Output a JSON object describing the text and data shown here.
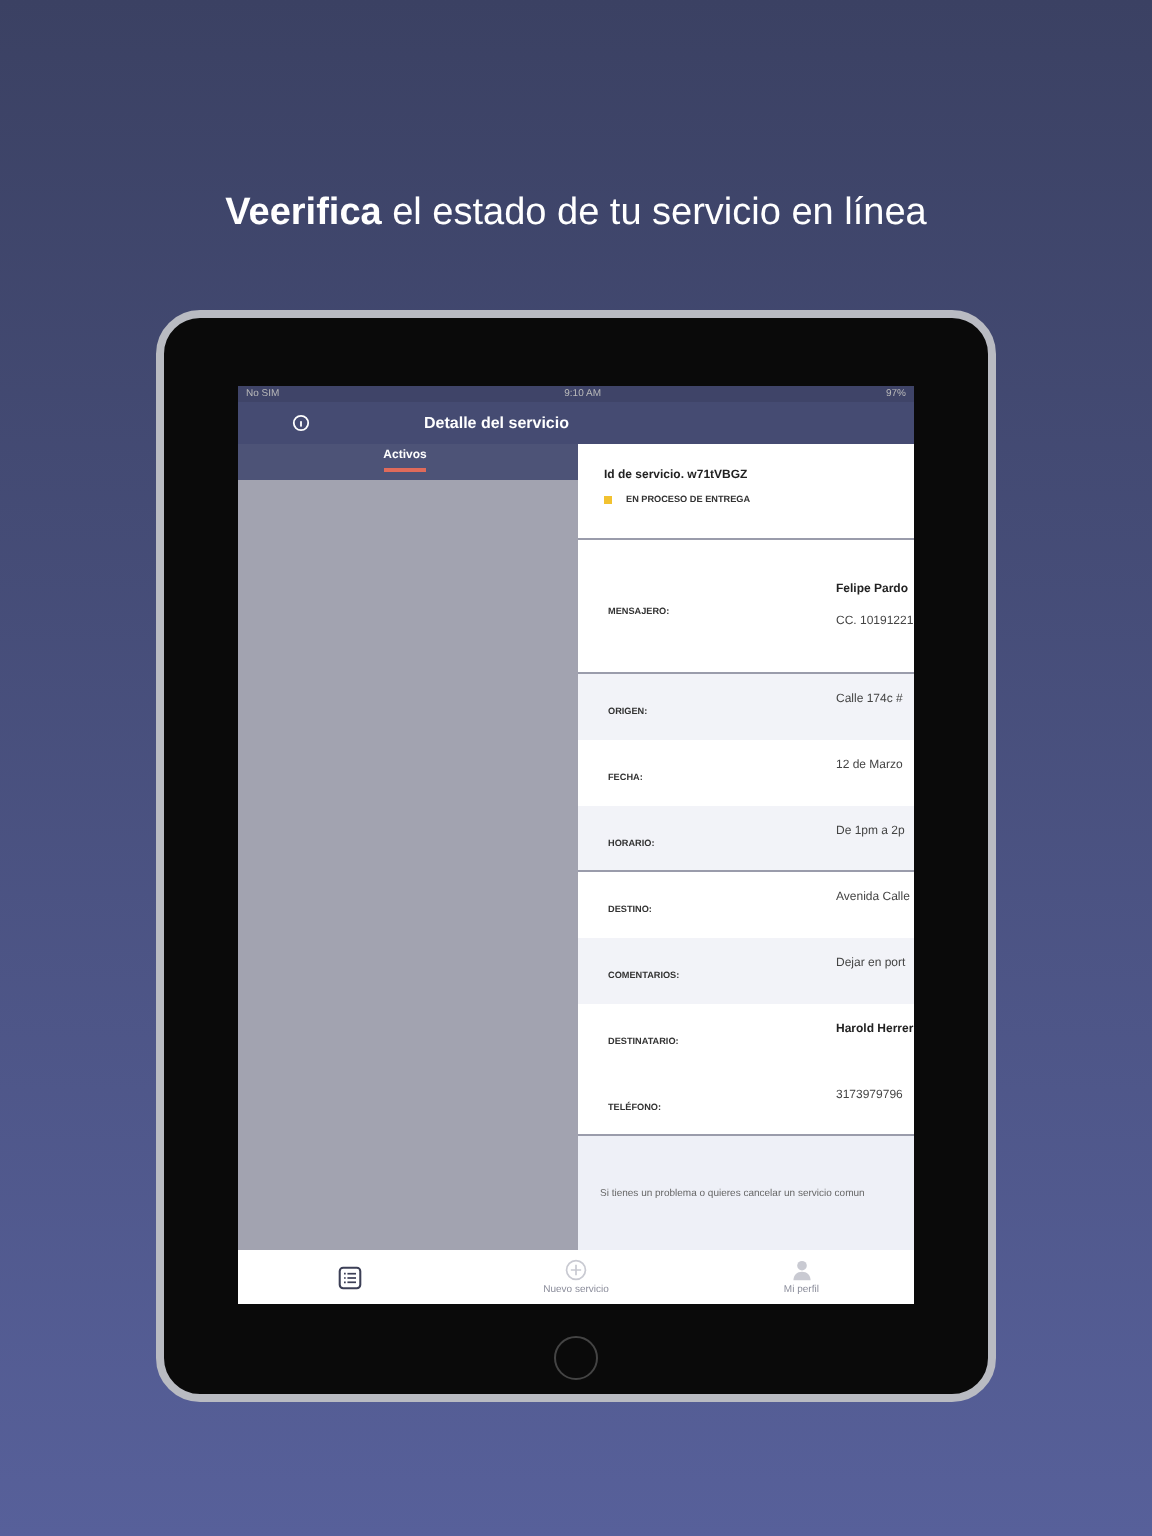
{
  "headline": "**Veerifica** el estado de tu servicio en línea",
  "status_bar": {
    "carrier": "No SIM",
    "time": "9:10 AM",
    "battery": "97%"
  },
  "nav": {
    "title": "Detalle del servicio"
  },
  "tabs": [
    {
      "label": "Activos",
      "selected": true
    }
  ],
  "service": {
    "id": "Id de servicio. w71tVBGZ",
    "status": {
      "text": "EN PROCESO DE ENTREGA",
      "color": "#f2c230"
    }
  },
  "rows": [
    {
      "label": "MENSAJERO:",
      "value": "Felipe Pardo",
      "value_2": "CC. 10191221",
      "emphasis": true,
      "shaded": false,
      "divider_after": true
    },
    {
      "label": "ORIGEN:",
      "value": "Calle 174c #",
      "emphasis": false,
      "shaded": true,
      "divider_after": false
    },
    {
      "label": "FECHA:",
      "value": "12 de Marzo",
      "emphasis": false,
      "shaded": false,
      "divider_after": false
    },
    {
      "label": "HORARIO:",
      "value": "De 1pm a 2p",
      "emphasis": false,
      "shaded": true,
      "divider_after": true
    },
    {
      "label": "DESTINO:",
      "value": "Avenida Calle",
      "emphasis": false,
      "shaded": false,
      "divider_after": false
    },
    {
      "label": "COMENTARIOS:",
      "value": "Dejar en port",
      "emphasis": false,
      "shaded": true,
      "divider_after": false
    },
    {
      "label": "DESTINATARIO:",
      "value": "Harold Herrer",
      "emphasis": true,
      "shaded": false,
      "divider_after": false
    },
    {
      "label": "TELÉFONO:",
      "value": "3173979796",
      "emphasis": false,
      "shaded": false,
      "divider_after": true
    }
  ],
  "footer_note": "Si tienes un problema o quieres cancelar un servicio comun",
  "tab_bar": [
    {
      "kind": "list",
      "selected": true
    },
    {
      "kind": "new",
      "label": "Nuevo servicio",
      "selected": false
    },
    {
      "kind": "profile",
      "label": "Mi perfil",
      "selected": false
    }
  ]
}
